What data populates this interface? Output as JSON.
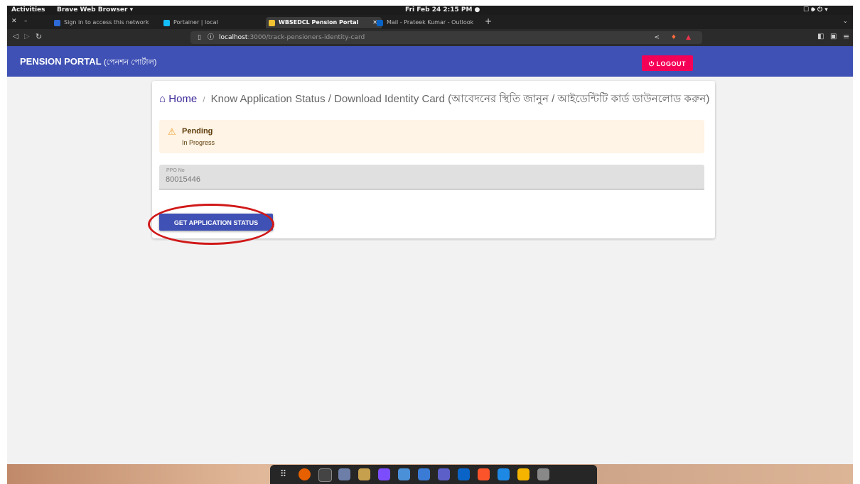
{
  "system_bar": {
    "activities": "Activities",
    "app_menu": "Brave Web Browser ▾",
    "clock": "Fri Feb 24  2:15 PM  ●",
    "tray": "☐ 🕪 ⏻ ▾"
  },
  "tabs": [
    {
      "title": "Sign in to access this network",
      "active": false,
      "color": "#2d6ad8"
    },
    {
      "title": "Portainer | local",
      "active": false,
      "color": "#13bef9"
    },
    {
      "title": "WBSEDCL Pension Portal",
      "active": true,
      "color": "#f1c232"
    },
    {
      "title": "Mail - Prateek Kumar - Outlook",
      "active": false,
      "color": "#0a64c8"
    }
  ],
  "new_tab": "+",
  "url": {
    "host": "localhost",
    "path": ":3000/track-pensioners-identity-card"
  },
  "header": {
    "brand": "PENSION PORTAL",
    "brand_bn": "(পেনশন পোর্টাল)",
    "logout": "⏻  LOGOUT"
  },
  "breadcrumb": {
    "home": "Home",
    "separator": "/",
    "current": "Know Application Status / Download Identity Card (আবেদনের স্থিতি জানুন / আইডেন্টিটি কার্ড ডাউনলোড করুন)"
  },
  "alert": {
    "title": "Pending",
    "message": "In Progress"
  },
  "ppo": {
    "label": "PPO No",
    "value": "80015446"
  },
  "button": {
    "label": "GET APPLICATION STATUS"
  },
  "colors": {
    "primary": "#3f51b5",
    "logout": "#f50057",
    "alert_bg": "#fff4e5",
    "highlight": "#d01818"
  }
}
